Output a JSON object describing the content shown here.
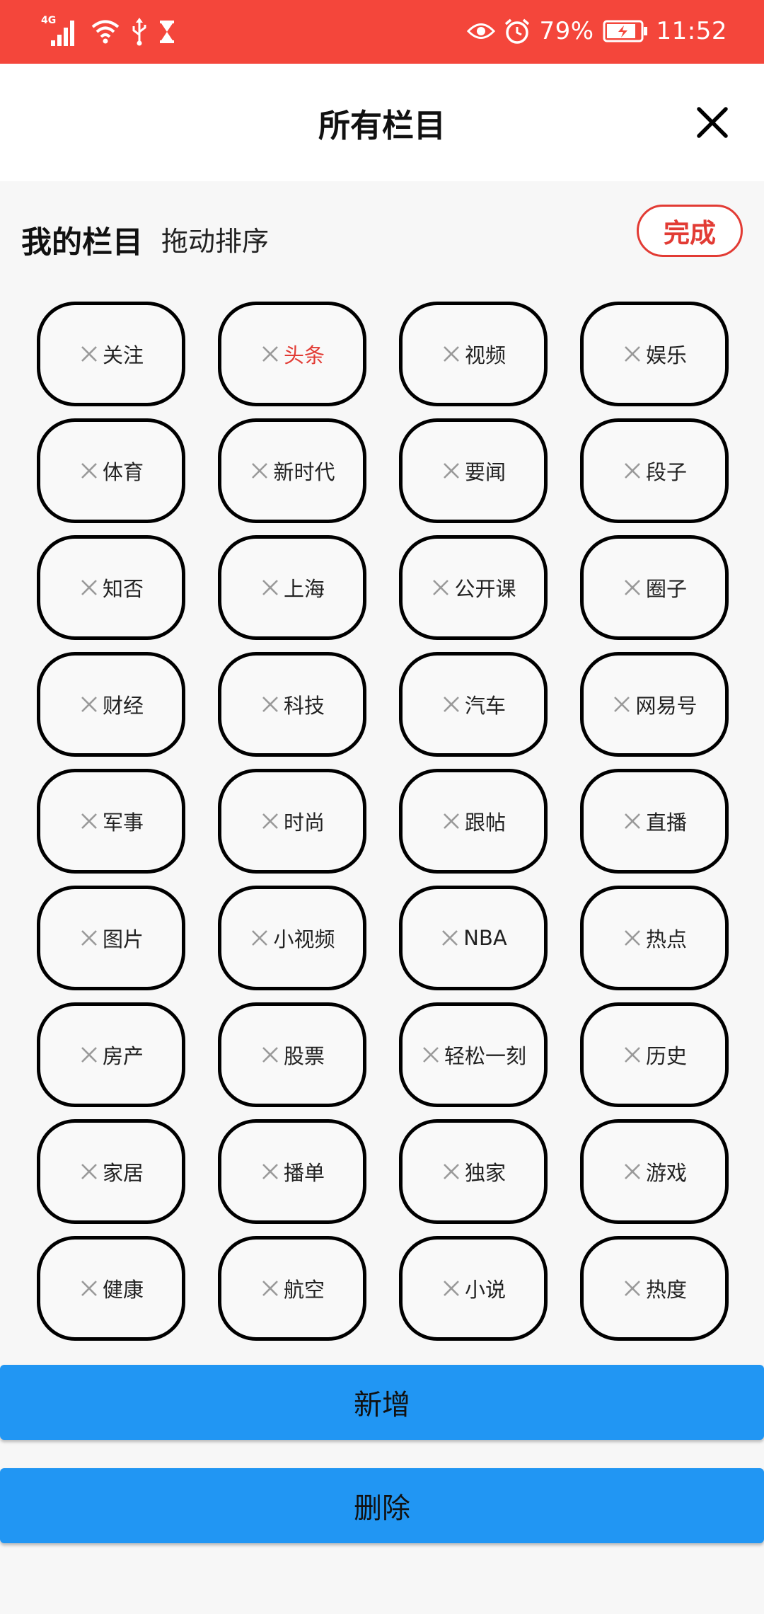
{
  "status_bar": {
    "network": "4G",
    "battery": "79%",
    "time": "11:52",
    "background": "#f4463b"
  },
  "header": {
    "title": "所有栏目",
    "close_icon": "close-icon"
  },
  "section": {
    "title": "我的栏目",
    "subtitle": "拖动排序",
    "done_label": "完成"
  },
  "channels": [
    {
      "label": "关注"
    },
    {
      "label": "头条",
      "active": true
    },
    {
      "label": "视频"
    },
    {
      "label": "娱乐"
    },
    {
      "label": "体育"
    },
    {
      "label": "新时代"
    },
    {
      "label": "要闻"
    },
    {
      "label": "段子"
    },
    {
      "label": "知否"
    },
    {
      "label": "上海"
    },
    {
      "label": "公开课"
    },
    {
      "label": "圈子"
    },
    {
      "label": "财经"
    },
    {
      "label": "科技"
    },
    {
      "label": "汽车"
    },
    {
      "label": "网易号"
    },
    {
      "label": "军事"
    },
    {
      "label": "时尚"
    },
    {
      "label": "跟帖"
    },
    {
      "label": "直播"
    },
    {
      "label": "图片"
    },
    {
      "label": "小视频"
    },
    {
      "label": "NBA"
    },
    {
      "label": "热点"
    },
    {
      "label": "房产"
    },
    {
      "label": "股票"
    },
    {
      "label": "轻松一刻"
    },
    {
      "label": "历史"
    },
    {
      "label": "家居"
    },
    {
      "label": "播单"
    },
    {
      "label": "独家"
    },
    {
      "label": "游戏"
    },
    {
      "label": "健康"
    },
    {
      "label": "航空"
    },
    {
      "label": "小说"
    },
    {
      "label": "热度"
    }
  ],
  "actions": {
    "add_label": "新增",
    "delete_label": "删除",
    "button_color": "#2196f3"
  },
  "colors": {
    "accent": "#e23b34"
  }
}
